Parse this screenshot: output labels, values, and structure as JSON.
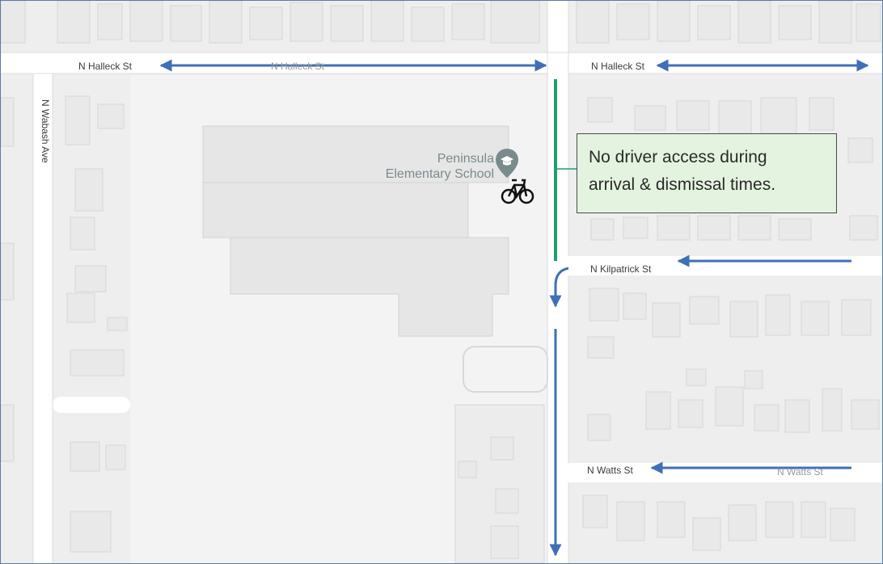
{
  "map": {
    "streets": {
      "halleck_west": "N Halleck St",
      "halleck_west_route": "N Halleck St",
      "halleck_east": "N Halleck St",
      "wabash": "N Wabash Ave",
      "kilpatrick": "N Kilpatrick St",
      "watts": "N Watts St",
      "watts_route": "N Watts St"
    },
    "poi": {
      "school_name": "Peninsula\nElementary School",
      "school_icon": "graduation-cap-pin-icon",
      "bike_icon": "bicycle-icon"
    },
    "callout": {
      "text": "No driver access during\narrival & dismissal times."
    },
    "colors": {
      "route_arrow": "#3f6fb6",
      "closure_line": "#1f9e6e",
      "callout_bg": "#e4f3df",
      "pin": "#7a8b8c",
      "map_bg": "#eeeeee",
      "road": "#ffffff"
    }
  }
}
